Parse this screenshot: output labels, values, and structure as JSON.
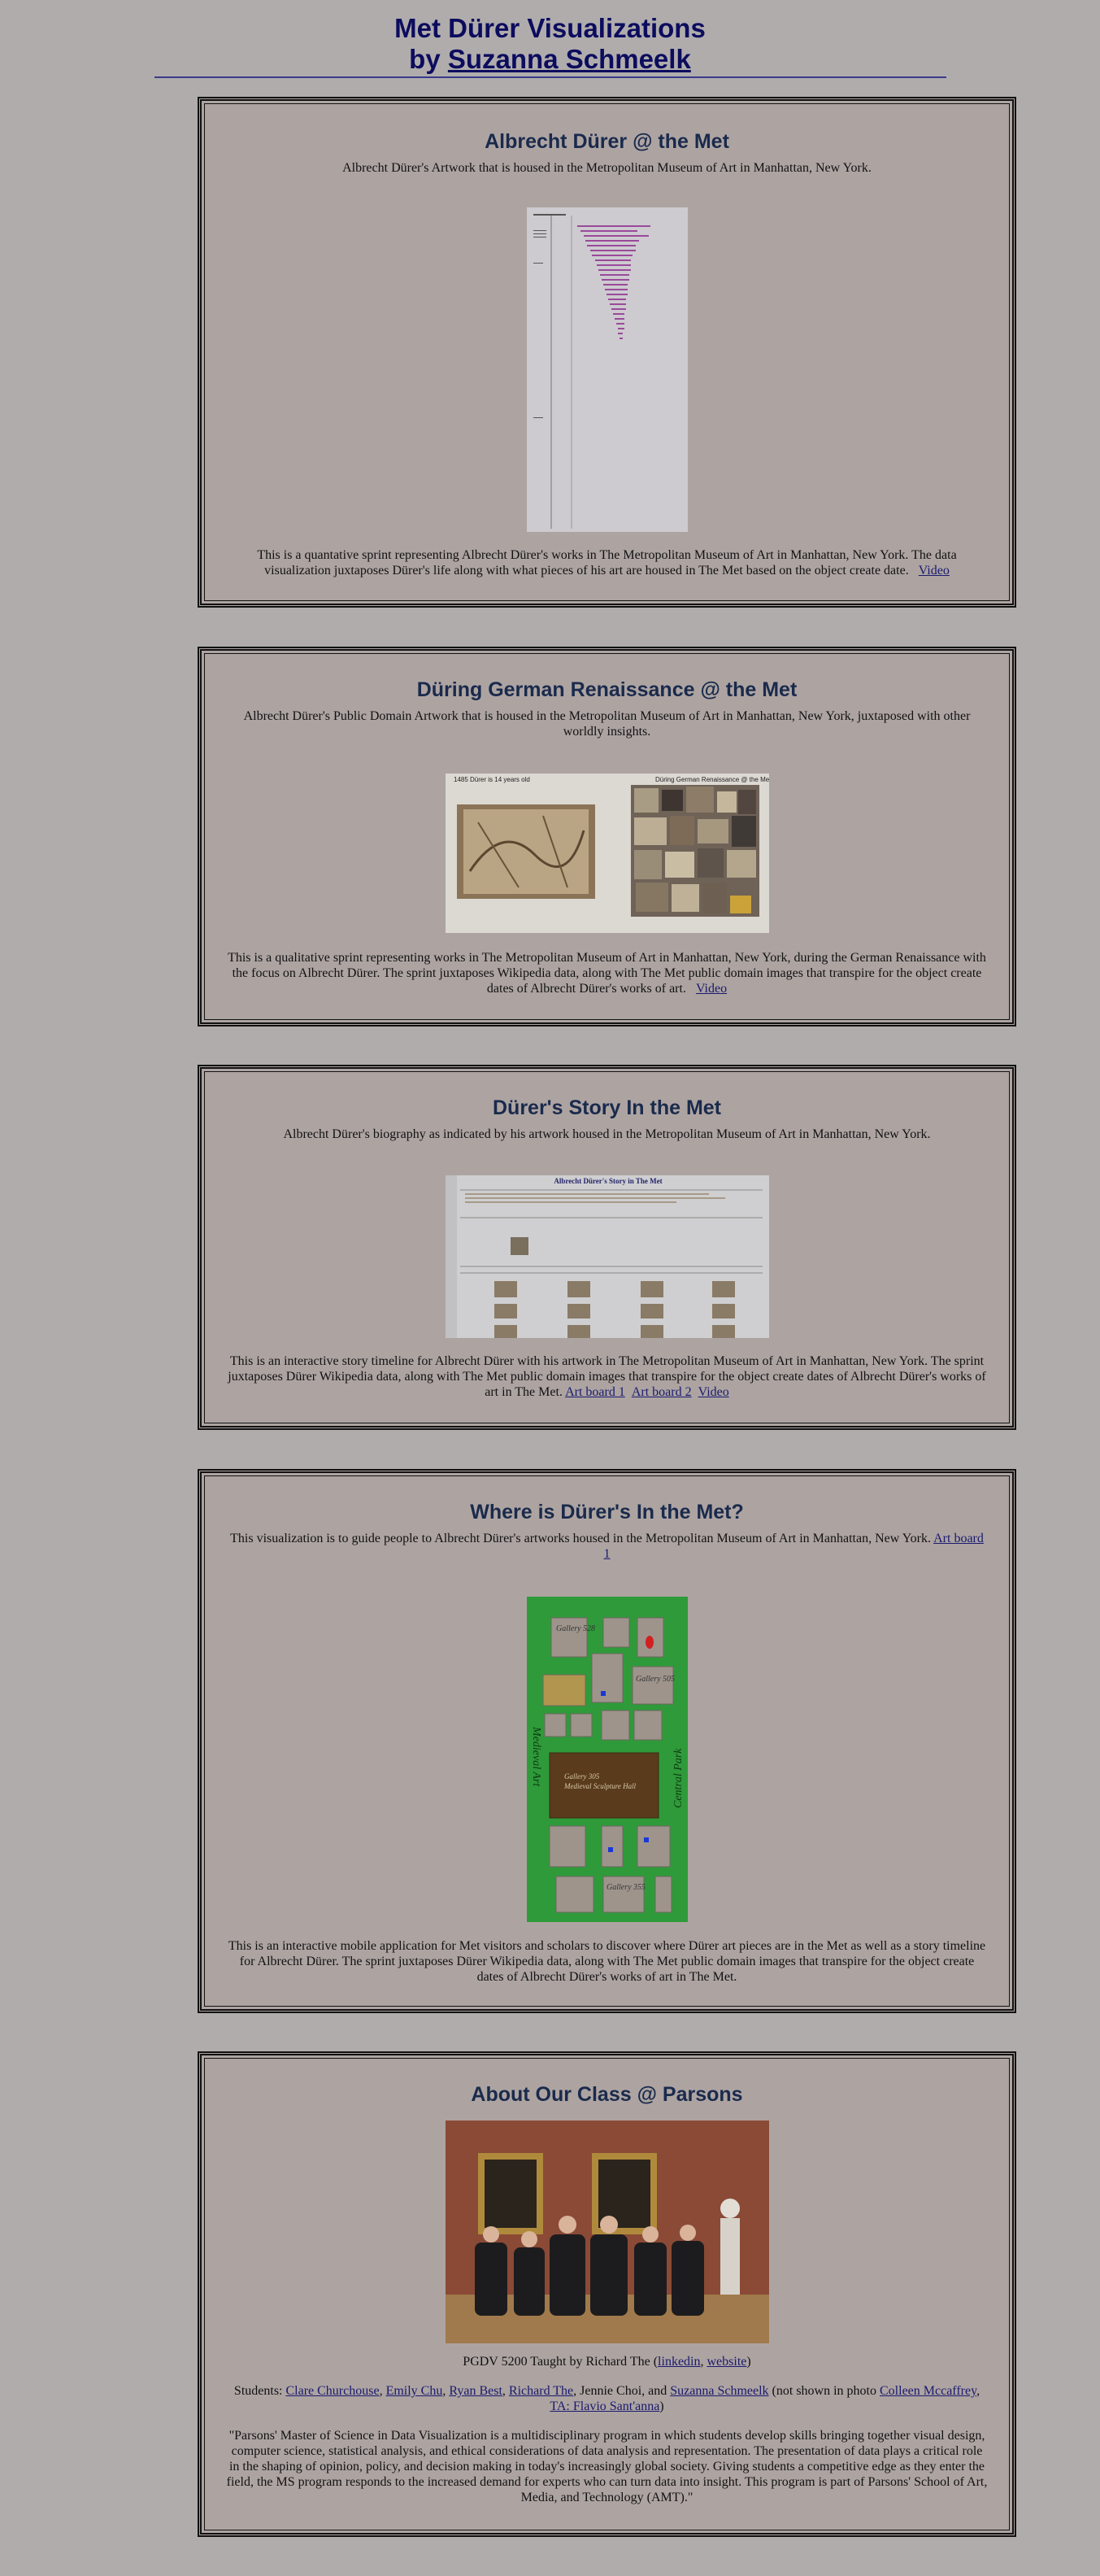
{
  "header": {
    "title_line1": "Met Dürer Visualizations",
    "title_by": "by ",
    "author_link": "Suzanna Schmeelk"
  },
  "sections": [
    {
      "title": "Albrecht Dürer @ the Met",
      "subtitle": "Albrecht Dürer's Artwork that is housed in the Metropolitan Museum of Art in Manhattan, New York.",
      "description": "This is a quantative sprint representing Albrecht Dürer's works in The Metropolitan Museum of Art in Manhattan, New York. The data visualization juxtaposes Dürer's life along with what pieces of his art are housed in The Met based on the object create date.",
      "links": [
        "Video"
      ]
    },
    {
      "title": "Düring German Renaissance @ the Met",
      "subtitle": "Albrecht Dürer's Public Domain Artwork that is housed in the Metropolitan Museum of Art in Manhattan, New York, juxtaposed with other worldly insights.",
      "image_caption_left": "1485   Dürer is 14 years old",
      "image_caption_right": "Düring German Renaissance @ the Met",
      "description": "This is a qualitative sprint representing works in The Metropolitan Museum of Art in Manhattan, New York, during the German Renaissance with the focus on Albrecht Dürer. The sprint juxtaposes Wikipedia data, along with The Met public domain images that transpire for the object create dates of Albrecht Dürer's works of art.",
      "links": [
        "Video"
      ]
    },
    {
      "title": "Dürer's Story In the Met",
      "subtitle": "Albrecht Dürer's biography as indicated by his artwork housed in the Metropolitan Museum of Art in Manhattan, New York.",
      "image_title": "Albrecht Dürer's Story in The Met",
      "description": "This is an interactive story timeline for Albrecht Dürer with his artwork in The Metropolitan Museum of Art in Manhattan, New York. The sprint juxtaposes Dürer Wikipedia data, along with The Met public domain images that transpire for the object create dates of Albrecht Dürer's works of art in The Met.",
      "links": [
        "Art board 1",
        "Art board 2",
        "Video"
      ]
    },
    {
      "title": "Where is Dürer's In the Met?",
      "subtitle": "This visualization is to guide people to Albrecht Dürer's artworks housed in the Metropolitan Museum of Art in Manhattan, New York.",
      "subtitle_link": "Art board 1",
      "map": {
        "gallery_528": "Gallery 528",
        "gallery_505": "Gallery 505",
        "gallery_305": "Gallery 305",
        "gallery_305_line2": "Medieval Sculpture Hall",
        "gallery_355": "Gallery 355",
        "left_label": "Medieval Art",
        "right_label": "Central Park"
      },
      "description": "This is an interactive mobile application for Met visitors and scholars to discover where Dürer art pieces are in the Met as well as a story timeline for Albrecht Dürer. The sprint juxtaposes Dürer Wikipedia data, along with The Met public domain images that transpire for the object create dates of Albrecht Dürer's works of art in The Met."
    },
    {
      "title": "About Our Class @ Parsons",
      "taught_prefix": "PGDV 5200 Taught by Richard The (",
      "taught_link1": "linkedin",
      "taught_sep": ", ",
      "taught_link2": "website",
      "taught_suffix": ")",
      "students_prefix": "Students: ",
      "students": [
        "Clare Churchouse",
        "Emily Chu",
        "Ryan Best",
        "Richard The"
      ],
      "student_plain": "Jennie Choi, and ",
      "student_last": "Suzanna Schmeelk",
      "not_shown_prefix": " (not shown in photo ",
      "not_shown_link1": "Colleen Mccaffrey",
      "not_shown_sep": ", ",
      "not_shown_link2": "TA: Flavio Sant'anna",
      "not_shown_suffix": ")",
      "quote": "\"Parsons' Master of Science in Data Visualization is a multidisciplinary program in which students develop skills bringing together visual design, computer science, statistical analysis, and ethical considerations of data analysis and representation. The presentation of data plays a critical role in the shaping of opinion, policy, and decision making in today's increasingly global society. Giving students a competitive edge as they enter the field, the MS program responds to the increased demand for experts who can turn data into insight. This program is part of Parsons' School of Art, Media, and Technology (AMT).\""
    }
  ],
  "colors": {
    "background": "#b0acac",
    "card": "#ada4a2",
    "heading": "#1a2a4c",
    "title": "#0c0c5e",
    "map_green": "#2f9a3a"
  }
}
